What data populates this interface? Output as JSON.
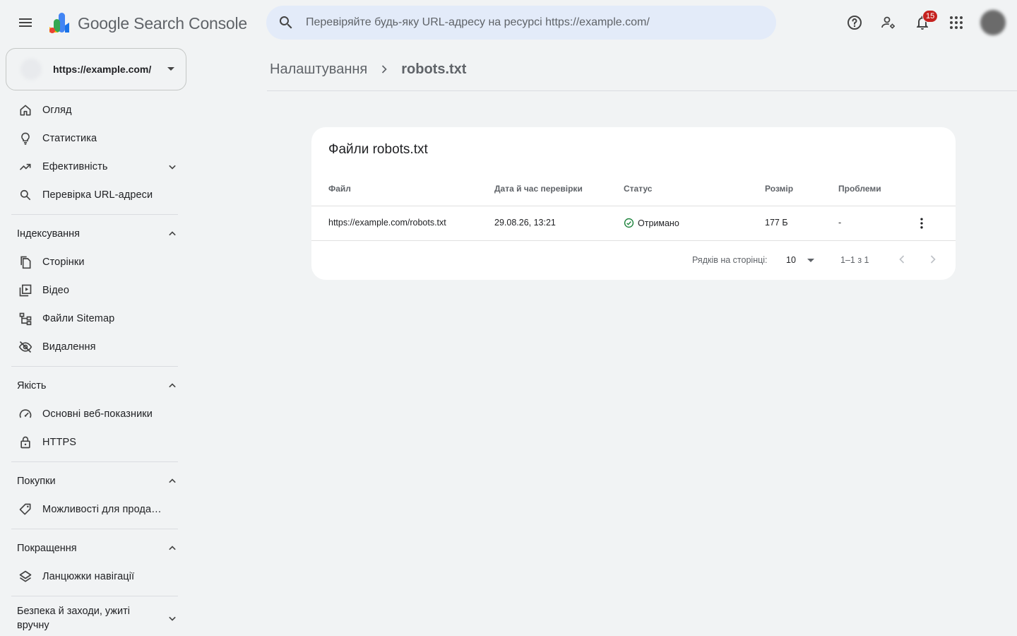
{
  "app": {
    "title_google": "Google",
    "title_product": "Search Console"
  },
  "search": {
    "placeholder": "Перевіряйте будь-яку URL-адресу на ресурсі https://example.com/"
  },
  "header": {
    "notifications_count": "15"
  },
  "property": {
    "url": "https://example.com/"
  },
  "sidebar": {
    "items": [
      {
        "label": "Огляд"
      },
      {
        "label": "Статистика"
      },
      {
        "label": "Ефективність"
      },
      {
        "label": "Перевірка URL-адреси"
      }
    ],
    "sections": [
      {
        "title": "Індексування",
        "items": [
          {
            "label": "Сторінки"
          },
          {
            "label": "Відео"
          },
          {
            "label": "Файли Sitemap"
          },
          {
            "label": "Видалення"
          }
        ]
      },
      {
        "title": "Якість",
        "items": [
          {
            "label": "Основні веб-показники"
          },
          {
            "label": "HTTPS"
          }
        ]
      },
      {
        "title": "Покупки",
        "items": [
          {
            "label": "Можливості для прода…"
          }
        ]
      },
      {
        "title": "Покращення",
        "items": [
          {
            "label": "Ланцюжки навігації"
          }
        ]
      },
      {
        "title": "Безпека й заходи, ужиті вручну"
      }
    ]
  },
  "breadcrumb": {
    "parent": "Налаштування",
    "current": "robots.txt"
  },
  "card": {
    "title": "Файли robots.txt",
    "columns": [
      "Файл",
      "Дата й час перевірки",
      "Статус",
      "Розмір",
      "Проблеми"
    ],
    "rows": [
      {
        "file": "https://example.com/robots.txt",
        "checked": "29.08.26, 13:21",
        "status": "Отримано",
        "size": "177 Б",
        "issues": "-"
      }
    ],
    "pager": {
      "rows_per_page_label": "Рядків на сторінці:",
      "rows_per_page": "10",
      "range": "1–1 з 1"
    }
  },
  "colors": {
    "background": "#f1f3f4",
    "search_bg": "#e3ebf9",
    "badge": "#c5221f",
    "status_ok": "#188038"
  }
}
